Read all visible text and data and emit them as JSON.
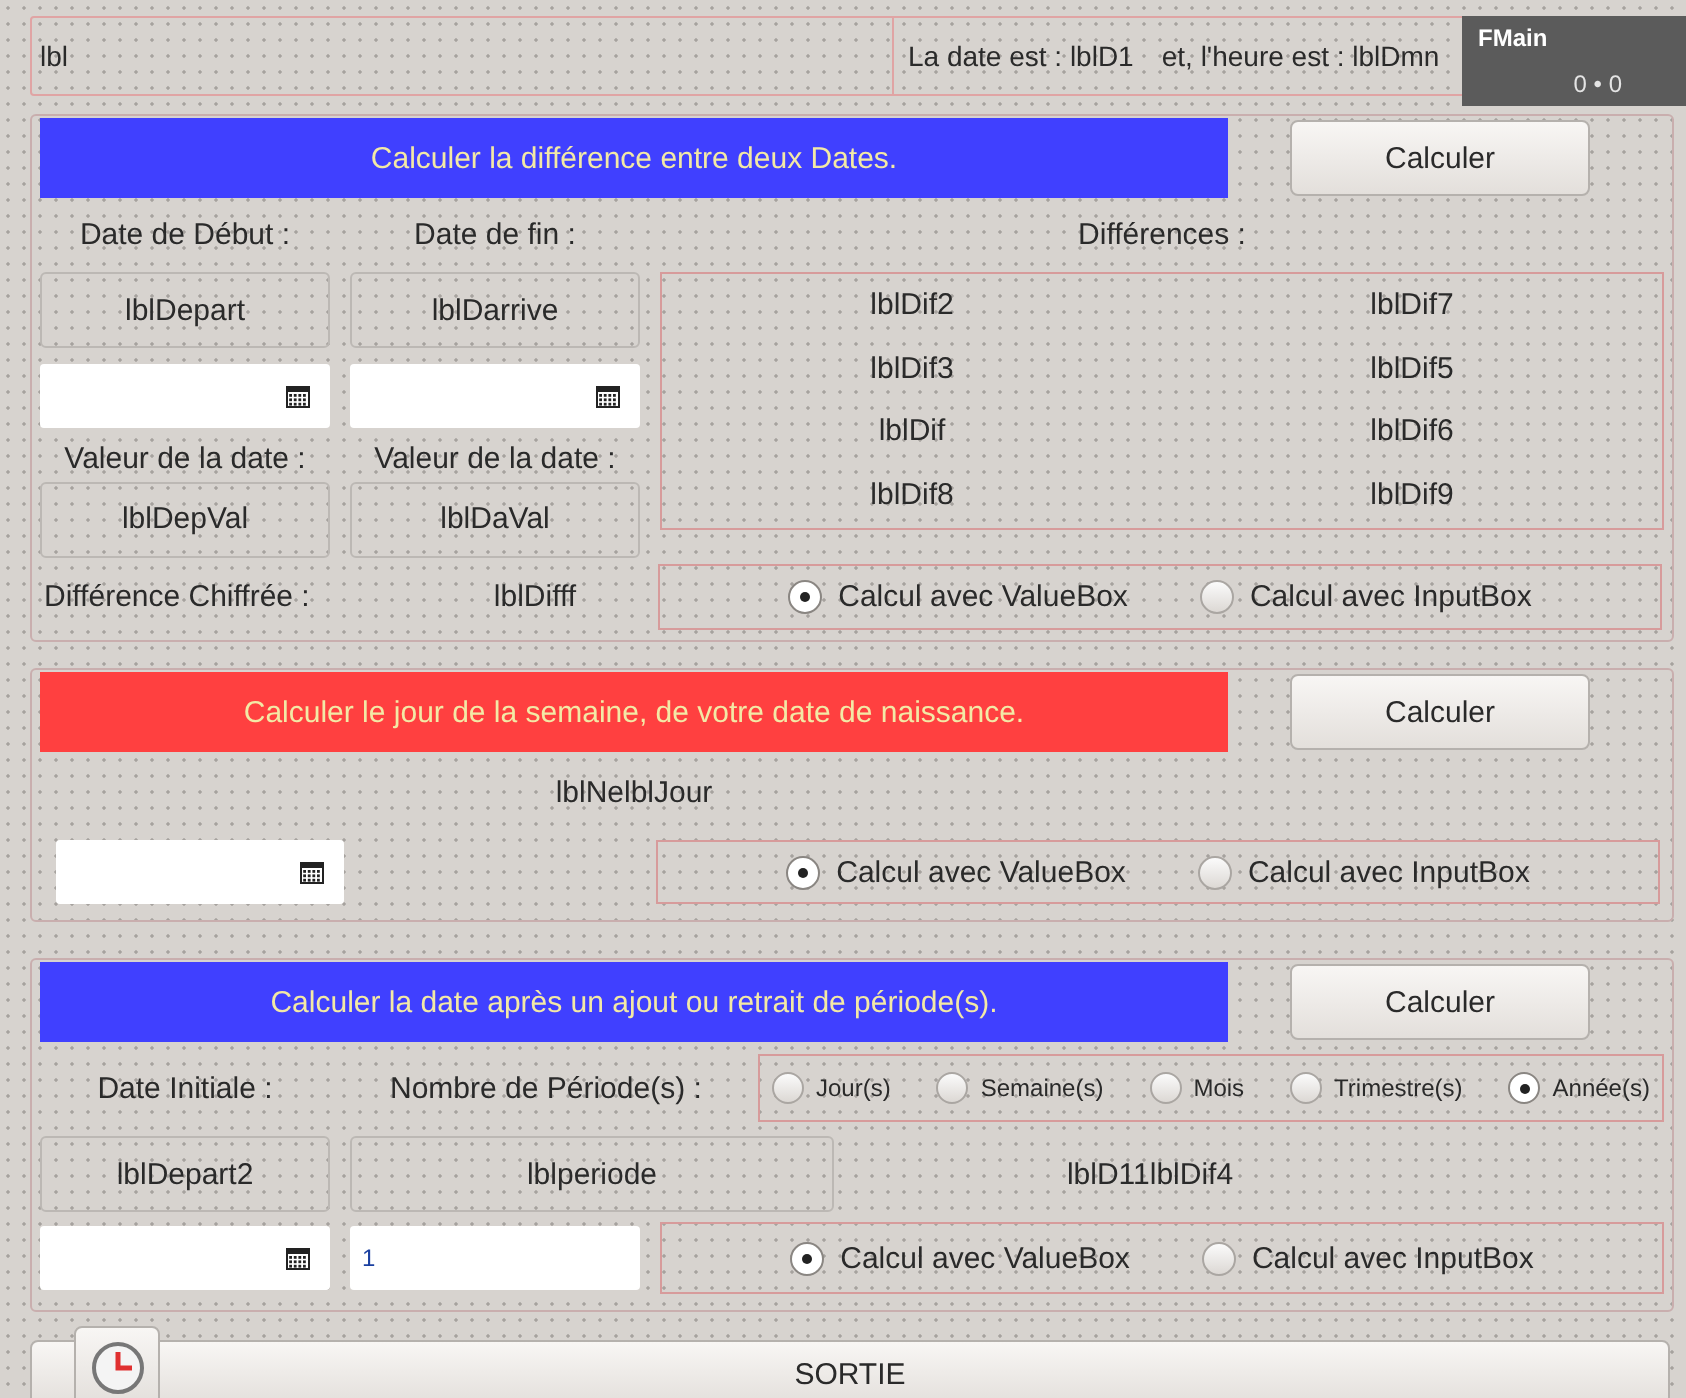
{
  "header": {
    "label": "lbl",
    "date_label": "La date est : lblD1",
    "time_label": "et, l'heure est : lblDmn"
  },
  "designer_badge": {
    "title": "FMain",
    "position": "0 • 0"
  },
  "sections": [
    {
      "kind": "difference",
      "title": "Calculer la différence entre deux Dates.",
      "color": "#4040ff",
      "button": "Calculer",
      "start_label": "Date de Début :",
      "end_label": "Date de fin :",
      "differences_title": "Différences  :",
      "start_value": "lblDepart",
      "end_value": "lblDarrive",
      "value_labels": [
        "Valeur de la date :",
        "Valeur de la date :"
      ],
      "value_boxes": [
        "lblDepVal",
        "lblDaVal"
      ],
      "differences": [
        "lblDif2",
        "lblDif7",
        "lblDif3",
        "lblDif5",
        "lblDif",
        "lblDif6",
        "lblDif8",
        "lblDif9"
      ],
      "numeric_label": "Différence Chiffrée :",
      "numeric_value": "lblDifff",
      "radios": [
        {
          "label": "Calcul avec ValueBox",
          "selected": true
        },
        {
          "label": "Calcul avec InputBox",
          "selected": false
        }
      ]
    },
    {
      "kind": "weekday",
      "title": "Calculer le jour de la semaine, de votre date de naissance.",
      "color": "#ff4040",
      "button": "Calculer",
      "result": "lblNelblJour",
      "radios": [
        {
          "label": "Calcul avec ValueBox",
          "selected": true
        },
        {
          "label": "Calcul avec InputBox",
          "selected": false
        }
      ]
    },
    {
      "kind": "period",
      "title": "Calculer la date après un ajout ou retrait de période(s).",
      "color": "#4040ff",
      "button": "Calculer",
      "start_label": "Date Initiale :",
      "count_label": "Nombre de Période(s) :",
      "periods": [
        {
          "label": "Jour(s)",
          "selected": false
        },
        {
          "label": "Semaine(s)",
          "selected": false
        },
        {
          "label": "Mois",
          "selected": false
        },
        {
          "label": "Trimestre(s)",
          "selected": false
        },
        {
          "label": "Année(s)",
          "selected": true
        }
      ],
      "start_value": "lblDepart2",
      "period_value": "lblperiode",
      "result": "lblD11lblDif4",
      "count_field": {
        "value": "1"
      },
      "radios": [
        {
          "label": "Calcul avec ValueBox",
          "selected": true
        },
        {
          "label": "Calcul avec InputBox",
          "selected": false
        }
      ]
    }
  ],
  "footer": {
    "button": "SORTIE"
  }
}
